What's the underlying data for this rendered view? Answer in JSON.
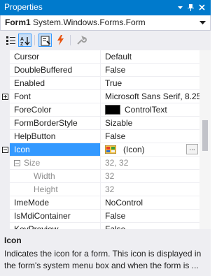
{
  "window": {
    "title": "Properties"
  },
  "object_selector": {
    "name": "Form1",
    "type": "System.Windows.Forms.Form"
  },
  "toolbar": {
    "buttons": [
      "categorized-icon",
      "alphabetical-icon",
      "properties-icon",
      "events-icon",
      "property-pages-icon"
    ]
  },
  "properties": [
    {
      "name": "Cursor",
      "value": "Default"
    },
    {
      "name": "DoubleBuffered",
      "value": "False"
    },
    {
      "name": "Enabled",
      "value": "True"
    },
    {
      "name": "Font",
      "value": "Microsoft Sans Serif, 8.25"
    },
    {
      "name": "ForeColor",
      "value": "ControlText",
      "color": "#000000"
    },
    {
      "name": "FormBorderStyle",
      "value": "Sizable"
    },
    {
      "name": "HelpButton",
      "value": "False"
    },
    {
      "name": "Icon",
      "value": "(Icon)",
      "ellipsis": "..."
    },
    {
      "name": "Size",
      "value": "32, 32"
    },
    {
      "name": "Width",
      "value": "32"
    },
    {
      "name": "Height",
      "value": "32"
    },
    {
      "name": "ImeMode",
      "value": "NoControl"
    },
    {
      "name": "IsMdiContainer",
      "value": "False"
    },
    {
      "name": "KeyPreview",
      "value": "False"
    }
  ],
  "description": {
    "title": "Icon",
    "text": "Indicates the icon for a form. This icon is displayed in the form's system menu box and when the form is ..."
  },
  "colors": {
    "accent": "#007acc",
    "selection": "#3399ff",
    "panel": "#eeeef2"
  }
}
